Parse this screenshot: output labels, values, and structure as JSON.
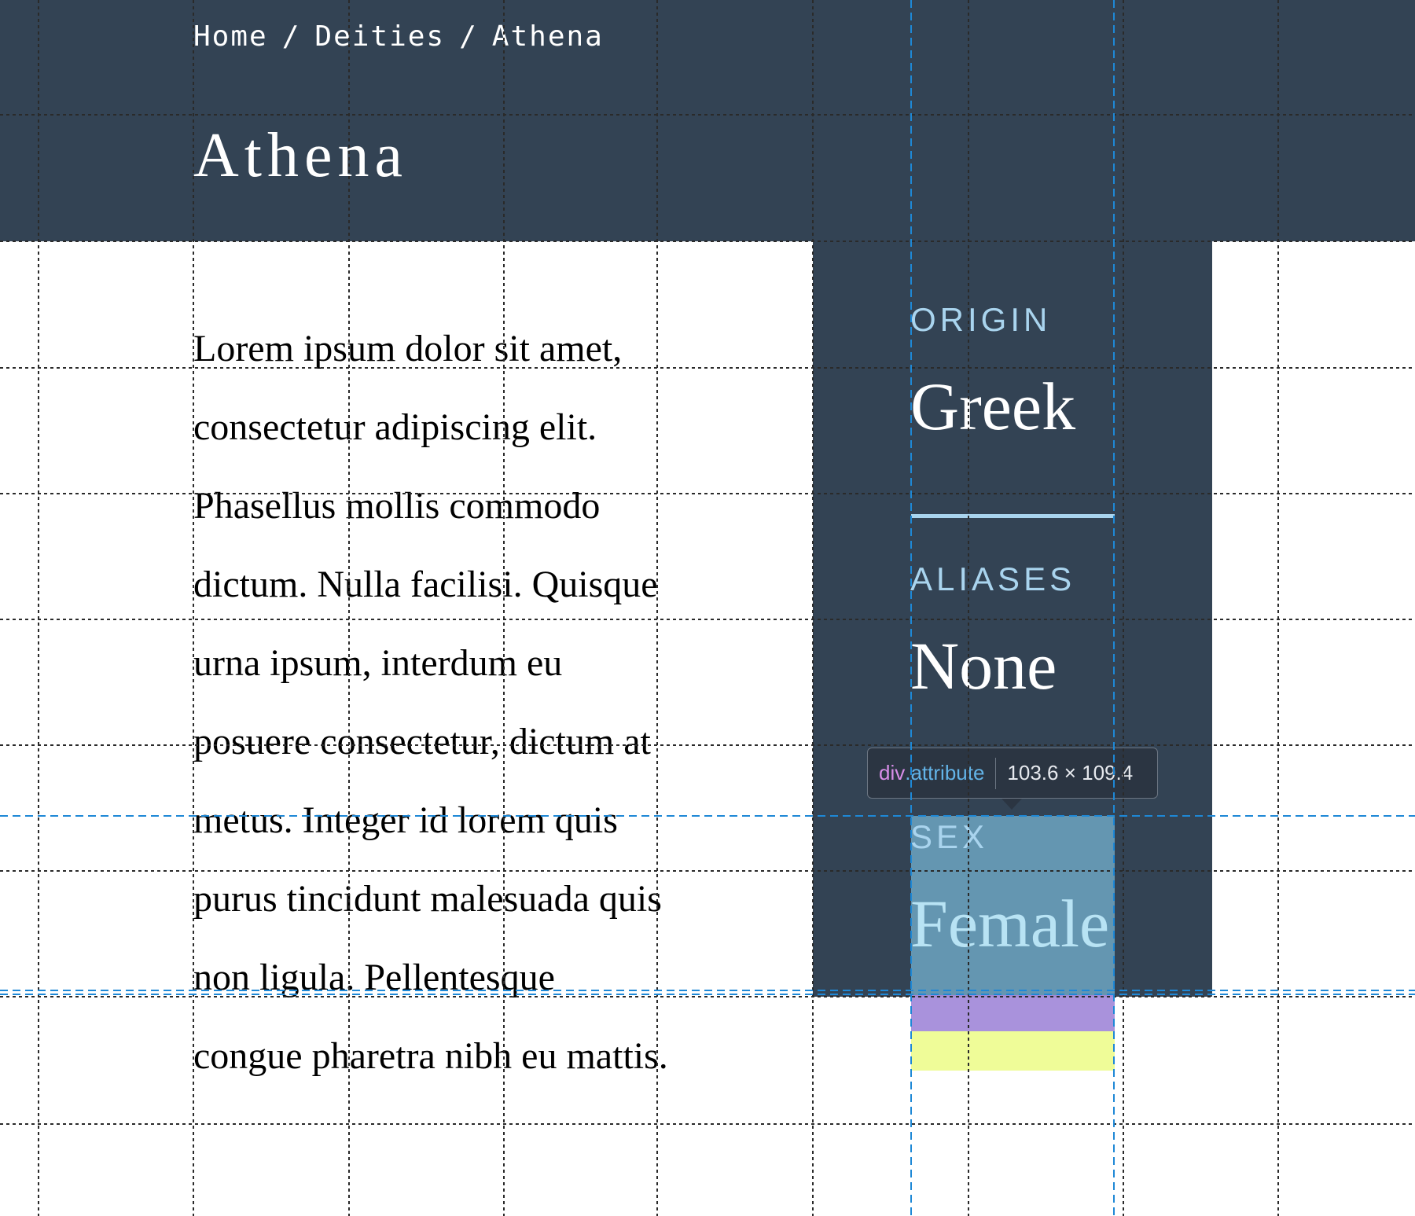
{
  "breadcrumb": {
    "items": [
      "Home",
      "Deities",
      "Athena"
    ],
    "separator": "/"
  },
  "page_title": "Athena",
  "body_paragraph": "Lorem ipsum dolor sit amet, consectetur adipiscing elit. Phasellus mollis commodo dictum. Nulla facilisi. Quisque urna ipsum, interdum eu posuere consectetur, dictum at metus. Integer id lorem quis purus tincidunt malesuada quis non ligula. Pellentesque congue pharetra nibh eu mattis.",
  "attributes": [
    {
      "label": "ORIGIN",
      "value": "Greek"
    },
    {
      "label": "ALIASES",
      "value": "None"
    },
    {
      "label": "SEX",
      "value": "Female"
    }
  ],
  "devtools_tooltip": {
    "tag": "div",
    "class_name": ".attribute",
    "size": "103.6 × 109.4"
  },
  "colors": {
    "header_bg": "#334354",
    "label_blue": "#a9d4ee",
    "highlight_content": "#6fa8c6",
    "highlight_padding": "#a48cda",
    "highlight_margin": "#eefc92"
  }
}
